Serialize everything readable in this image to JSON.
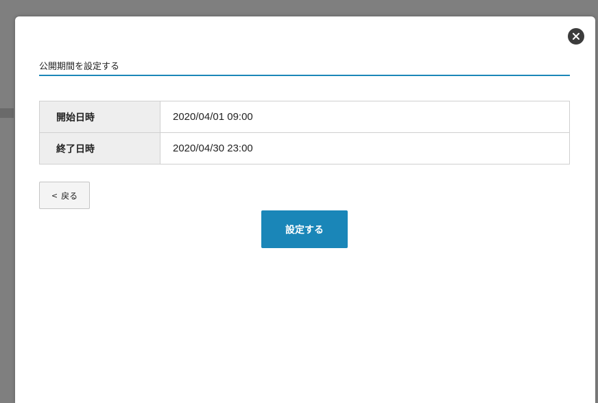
{
  "dialog": {
    "title": "公開期間を設定する",
    "close_icon": "close-icon"
  },
  "period_table": {
    "rows": [
      {
        "label": "開始日時",
        "value": "2020/04/01 09:00"
      },
      {
        "label": "終了日時",
        "value": "2020/04/30 23:00"
      }
    ]
  },
  "buttons": {
    "back_chevron": "<",
    "back_label": "戻る",
    "submit_label": "設定する"
  },
  "colors": {
    "accent": "#1a86b8",
    "overlay": "#7f7f7f",
    "header_cell_bg": "#eeeeee"
  }
}
